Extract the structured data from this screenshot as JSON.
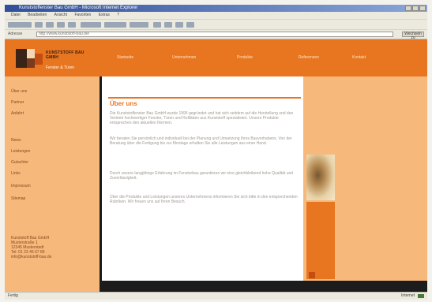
{
  "window": {
    "title": "Kunststoffenster Bau GmbH - Microsoft Internet Explorer"
  },
  "menubar": {
    "items": [
      "Datei",
      "Bearbeiten",
      "Ansicht",
      "Favoriten",
      "Extras",
      "?"
    ]
  },
  "address": {
    "label": "Adresse",
    "url": "http://www.kunststoff-bau.de/",
    "go_label": "Wechseln zu"
  },
  "site": {
    "logo_text": "KUNSTSTOFF BAU GMBH",
    "logo_sub": "Fenster & Türen",
    "nav": [
      "Startseite",
      "Unternehmen",
      "Produkte",
      "Referenzen",
      "Kontakt"
    ],
    "sidebar": [
      "Über uns",
      "Partner",
      "Anfahrt",
      "News",
      "Leistungen",
      "Gutachter",
      "Links",
      "Impressum",
      "Sitemap"
    ],
    "contact": [
      "Kunststoff Bau GmbH",
      "Musterstraße 1",
      "12345 Musterstadt",
      "Tel: 01 23 45 67 89",
      "info@kunststoff-bau.de"
    ],
    "content": {
      "heading": "Über uns",
      "paragraphs": [
        "Die Kunststoffenster Bau GmbH wurde 1995 gegründet und hat sich seitdem auf die Herstellung und den Vertrieb hochwertiger Fenster, Türen und Rollläden aus Kunststoff spezialisiert. Unsere Produkte entsprechen den aktuellen Normen.",
        "Wir beraten Sie persönlich und individuell bei der Planung und Umsetzung Ihres Bauvorhabens. Von der Beratung über die Fertigung bis zur Montage erhalten Sie alle Leistungen aus einer Hand.",
        "Durch unsere langjährige Erfahrung im Fensterbau garantieren wir eine gleichbleibend hohe Qualität und Zuverlässigkeit.",
        "Über die Produkte und Leistungen unseres Unternehmens informieren Sie sich bitte in den entsprechenden Rubriken. Wir freuen uns auf Ihren Besuch."
      ]
    }
  },
  "status": {
    "left": "Fertig",
    "right": "Internet"
  }
}
